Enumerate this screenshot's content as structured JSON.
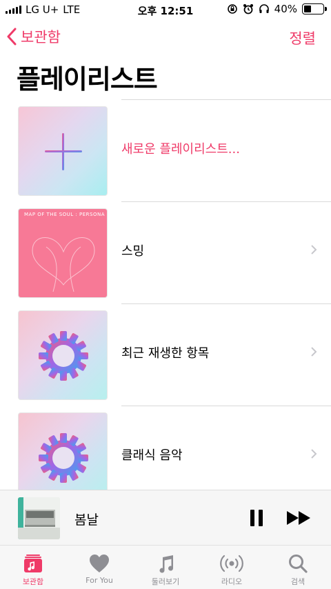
{
  "status_bar": {
    "carrier": "LG U+",
    "network": "LTE",
    "time": "오후 12:51",
    "battery_percent": "40%",
    "battery_level": 0.4
  },
  "nav": {
    "back_label": "보관함",
    "sort_label": "정렬"
  },
  "page": {
    "title": "플레이리스트"
  },
  "playlists": [
    {
      "label": "새로운 플레이리스트...",
      "artwork": "plus-icon",
      "accent": true
    },
    {
      "label": "스밍",
      "artwork": "album-art",
      "art_text": "MAP OF THE SOUL : PERSONA"
    },
    {
      "label": "최근 재생한 항목",
      "artwork": "gear-icon"
    },
    {
      "label": "클래식 음악",
      "artwork": "gear-icon"
    }
  ],
  "mini_player": {
    "title": "봄날"
  },
  "tabs": [
    {
      "label": "보관함",
      "icon": "library-icon",
      "active": true
    },
    {
      "label": "For You",
      "icon": "heart-icon"
    },
    {
      "label": "둘러보기",
      "icon": "music-note-icon"
    },
    {
      "label": "라디오",
      "icon": "radio-icon"
    },
    {
      "label": "검색",
      "icon": "search-icon"
    }
  ],
  "colors": {
    "accent": "#ef3a68",
    "inactive": "#8e8e93"
  }
}
